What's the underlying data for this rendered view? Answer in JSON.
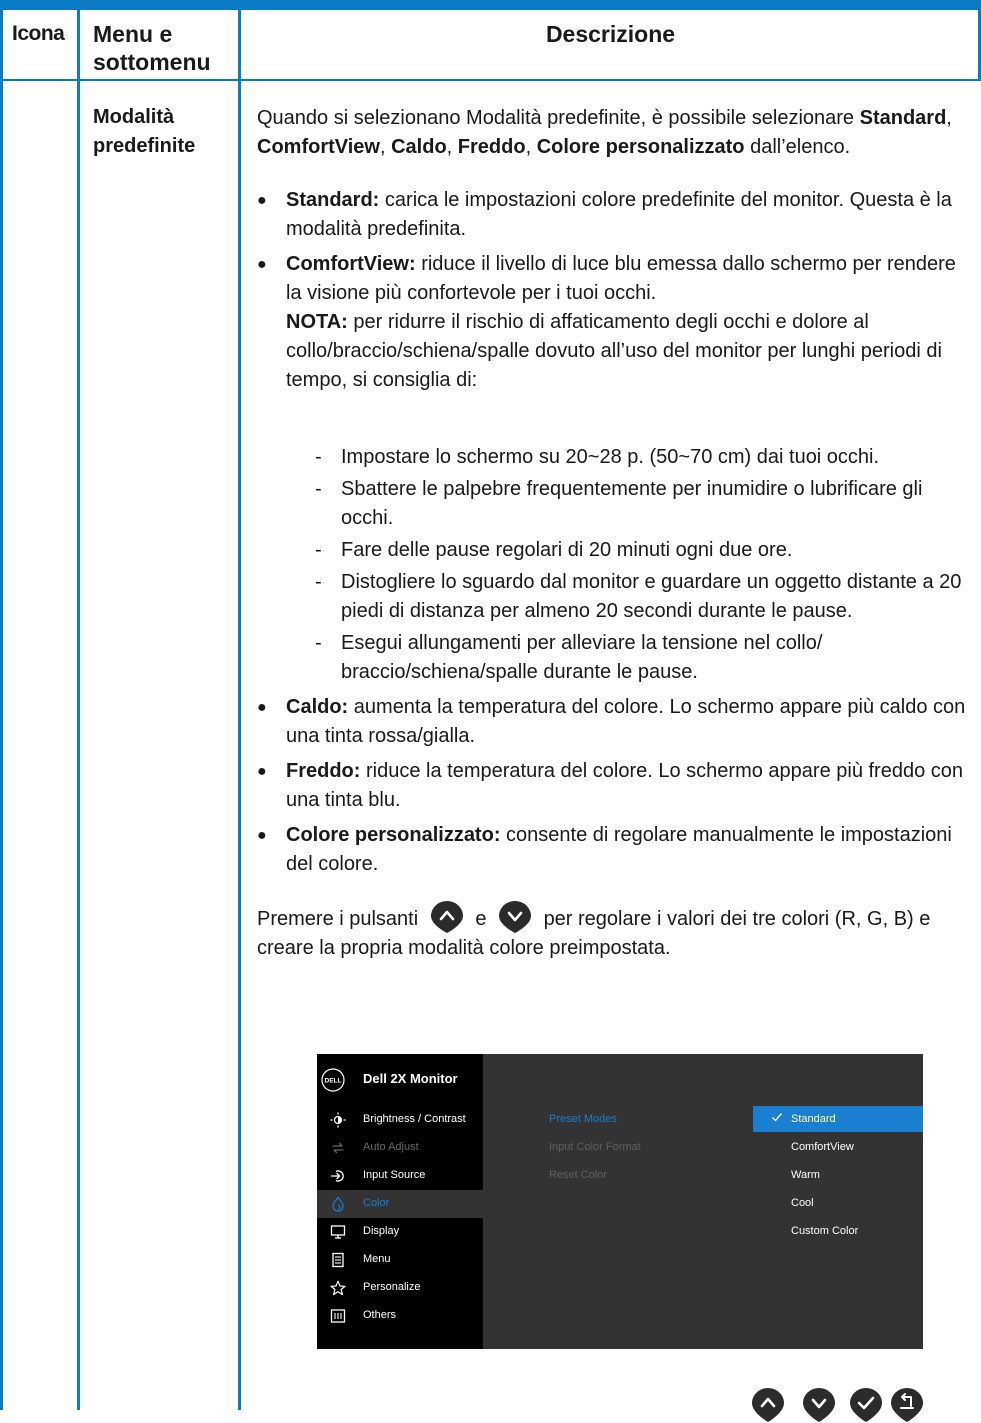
{
  "table": {
    "header": {
      "icon": "Icona",
      "menu": "Menu e sottomenu",
      "description": "Descrizione"
    },
    "row_label": "Modalità predefinite"
  },
  "content": {
    "intro_prefix": "Quando si selezionano Modalità predefinite, è possibile selezionare",
    "intro_opts": [
      "Standard",
      "ComfortView",
      "Caldo",
      "Freddo",
      "Colore personalizzato"
    ],
    "intro_suffix": "dall’elenco.",
    "bullets": [
      {
        "term": "Standard:",
        "text": "carica le impostazioni colore predefinite del monitor. Questa è la modalità predefinita."
      },
      {
        "term": "ComfortView:",
        "text": "riduce il livello di luce blu emessa dallo schermo per rendere la visione più confortevole per i tuoi occhi."
      },
      {
        "term": "Caldo:",
        "text": "aumenta la temperatura del colore. Lo schermo appare più caldo con una tinta rossa/gialla."
      },
      {
        "term": "Freddo:",
        "text": "riduce la temperatura del colore. Lo schermo appare più freddo con una tinta blu."
      },
      {
        "term": "Colore personalizzato:",
        "text": "consente di regolare manualmente le impostazioni del colore."
      }
    ],
    "note_label": "NOTA:",
    "note_text": "per ridurre il rischio di affaticamento degli occhi e dolore al collo/braccio/schiena/spalle dovuto all’uso del monitor per lunghi periodi di tempo, si consiglia di:",
    "tips": [
      "Impostare lo schermo su 20~28 p. (50~70 cm) dai tuoi occhi.",
      "Sbattere le palpebre frequentemente per inumidire o lubrificare gli occhi.",
      "Fare delle pause regolari di 20 minuti ogni due ore.",
      "Distogliere lo sguardo dal monitor e guardare un oggetto distante a 20 piedi di distanza per almeno 20 secondi durante le pause.",
      "Esegui allungamenti per alleviare la tensione nel collo/ braccio/schiena/spalle durante le pause."
    ],
    "press_prefix": "Premere i pulsanti",
    "press_and": "e",
    "press_suffix": "per regolare i valori dei tre colori (R, G, B) e creare la propria modalità colore preimpostata."
  },
  "osd": {
    "logo_text": "DELL",
    "title": "Dell 2X Monitor",
    "menu": [
      {
        "label": "Brightness / Contrast",
        "icon": "brightness-icon",
        "state": "normal"
      },
      {
        "label": "Auto Adjust",
        "icon": "auto-adjust-icon",
        "state": "dim"
      },
      {
        "label": "Input Source",
        "icon": "input-source-icon",
        "state": "normal"
      },
      {
        "label": "Color",
        "icon": "color-icon",
        "state": "active"
      },
      {
        "label": "Display",
        "icon": "display-icon",
        "state": "normal"
      },
      {
        "label": "Menu",
        "icon": "menu-icon",
        "state": "normal"
      },
      {
        "label": "Personalize",
        "icon": "star-icon",
        "state": "normal"
      },
      {
        "label": "Others",
        "icon": "others-icon",
        "state": "normal"
      }
    ],
    "submenu": [
      {
        "label": "Preset Modes",
        "state": "active"
      },
      {
        "label": "Input Color Format",
        "state": "dim"
      },
      {
        "label": "Reset Color",
        "state": "dim"
      }
    ],
    "options": [
      {
        "label": "Standard",
        "selected": true
      },
      {
        "label": "ComfortView",
        "selected": false
      },
      {
        "label": "Warm",
        "selected": false
      },
      {
        "label": "Cool",
        "selected": false
      },
      {
        "label": "Custom Color",
        "selected": false
      }
    ],
    "nav_buttons": [
      "up-button-icon",
      "down-button-icon",
      "confirm-button-icon",
      "back-button-icon"
    ]
  },
  "colors": {
    "accent": "#0a7bc4",
    "osd_highlight": "#1a7fd0"
  }
}
